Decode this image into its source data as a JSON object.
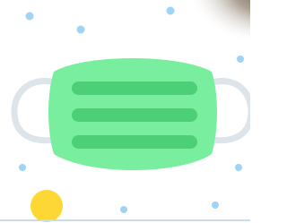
{
  "colors": {
    "background": "#ffffff",
    "mask_body": "#78ee9e",
    "mask_pleats": "#4dcf77",
    "ear_loops": "#dde5ea",
    "dots": "#9fd4f5",
    "sun": "#fdd835",
    "corner_shadow": "#6a5a4a",
    "bottom_line": "#c9dde8"
  },
  "illustration": {
    "subject": "face-mask",
    "pleat_count": 3,
    "decorations": [
      "blue-dots",
      "yellow-circle",
      "corner-shadow"
    ]
  }
}
